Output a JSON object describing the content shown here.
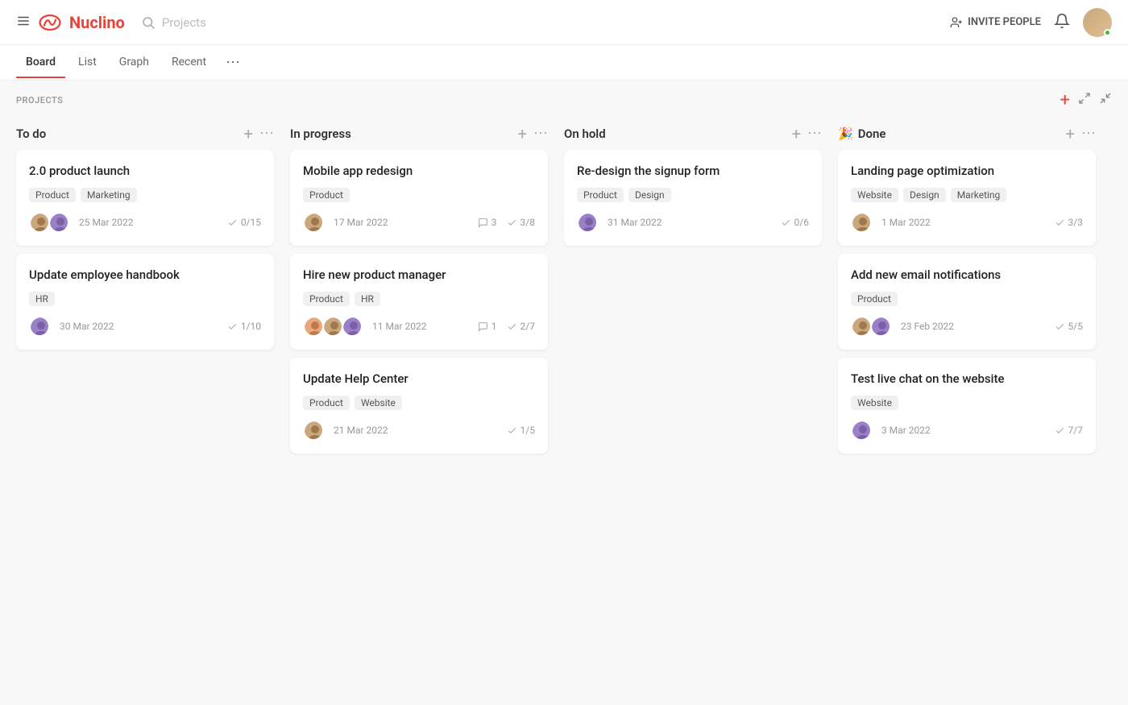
{
  "header": {
    "logo_text": "Nuclino",
    "search_placeholder": "Projects",
    "invite_label": "INVITE PEOPLE",
    "hamburger_icon": "hamburger-icon",
    "search_icon": "search-icon",
    "bell_icon": "bell-icon"
  },
  "nav": {
    "tabs": [
      {
        "id": "board",
        "label": "Board",
        "active": true
      },
      {
        "id": "list",
        "label": "List",
        "active": false
      },
      {
        "id": "graph",
        "label": "Graph",
        "active": false
      },
      {
        "id": "recent",
        "label": "Recent",
        "active": false
      }
    ],
    "more_label": "⋯"
  },
  "board": {
    "section_title": "PROJECTS",
    "columns": [
      {
        "id": "todo",
        "title": "To do",
        "emoji": "",
        "cards": [
          {
            "id": "c1",
            "title": "2.0 product launch",
            "tags": [
              "Product",
              "Marketing"
            ],
            "avatars": [
              "av1",
              "av2"
            ],
            "date": "25 Mar 2022",
            "checks": "0/15",
            "comments": null
          },
          {
            "id": "c2",
            "title": "Update employee handbook",
            "tags": [
              "HR"
            ],
            "avatars": [
              "av2"
            ],
            "date": "30 Mar 2022",
            "checks": "1/10",
            "comments": null
          }
        ]
      },
      {
        "id": "inprogress",
        "title": "In progress",
        "emoji": "",
        "cards": [
          {
            "id": "c3",
            "title": "Mobile app redesign",
            "tags": [
              "Product"
            ],
            "avatars": [
              "av1"
            ],
            "date": "17 Mar 2022",
            "checks": "3/8",
            "comments": "3"
          },
          {
            "id": "c4",
            "title": "Hire new product manager",
            "tags": [
              "Product",
              "HR"
            ],
            "avatars": [
              "av3",
              "av1",
              "av2"
            ],
            "date": "11 Mar 2022",
            "checks": "2/7",
            "comments": "1"
          },
          {
            "id": "c5",
            "title": "Update Help Center",
            "tags": [
              "Product",
              "Website"
            ],
            "avatars": [
              "av1"
            ],
            "date": "21 Mar 2022",
            "checks": "1/5",
            "comments": null
          }
        ]
      },
      {
        "id": "onhold",
        "title": "On hold",
        "emoji": "",
        "cards": [
          {
            "id": "c6",
            "title": "Re-design the signup form",
            "tags": [
              "Product",
              "Design"
            ],
            "avatars": [
              "av2"
            ],
            "date": "31 Mar 2022",
            "checks": "0/6",
            "comments": null
          }
        ]
      },
      {
        "id": "done",
        "title": "Done",
        "emoji": "🎉",
        "cards": [
          {
            "id": "c7",
            "title": "Landing page optimization",
            "tags": [
              "Website",
              "Design",
              "Marketing"
            ],
            "avatars": [
              "av1"
            ],
            "date": "1 Mar 2022",
            "checks": "3/3",
            "comments": null
          },
          {
            "id": "c8",
            "title": "Add new email notifications",
            "tags": [
              "Product"
            ],
            "avatars": [
              "av1",
              "av2"
            ],
            "date": "23 Feb 2022",
            "checks": "5/5",
            "comments": null
          },
          {
            "id": "c9",
            "title": "Test live chat on the website",
            "tags": [
              "Website"
            ],
            "avatars": [
              "av2"
            ],
            "date": "3 Mar 2022",
            "checks": "7/7",
            "comments": null
          }
        ]
      }
    ]
  }
}
